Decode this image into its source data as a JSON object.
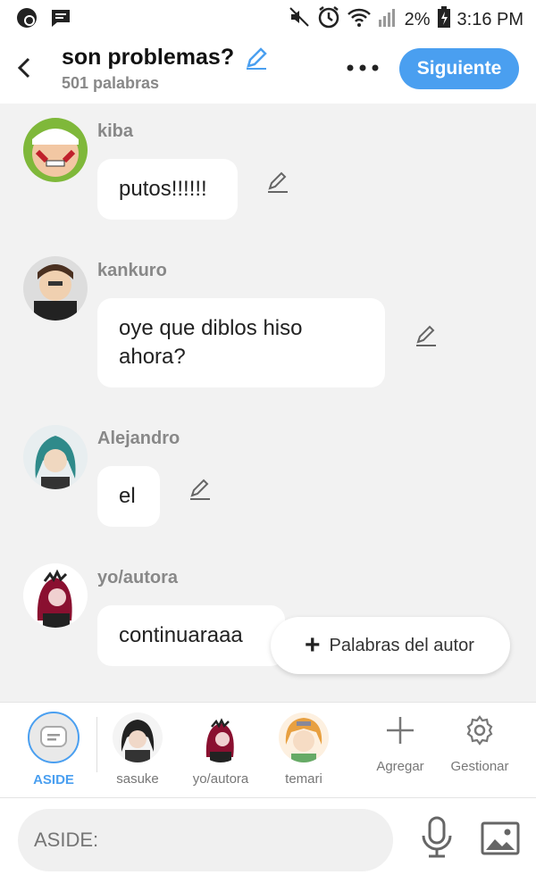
{
  "status": {
    "battery": "2%",
    "time": "3:16 PM"
  },
  "header": {
    "title": "son problemas?",
    "subtitle": "501 palabras",
    "next_label": "Siguiente"
  },
  "messages": [
    {
      "name": "kiba",
      "text": "putos!!!!!!"
    },
    {
      "name": "kankuro",
      "text": "oye que diblos hiso ahora?"
    },
    {
      "name": "Alejandro",
      "text": "el"
    },
    {
      "name": "yo/autora",
      "text": "continuaraaa"
    }
  ],
  "fab": {
    "label": "Palabras del autor"
  },
  "characters": [
    {
      "label": "ASIDE"
    },
    {
      "label": "sasuke"
    },
    {
      "label": "yo/autora"
    },
    {
      "label": "temari"
    }
  ],
  "tools": {
    "add_label": "Agregar",
    "manage_label": "Gestionar"
  },
  "input": {
    "placeholder": "ASIDE:"
  },
  "colors": {
    "accent": "#4a9ff0",
    "background": "#f2f2f2"
  }
}
